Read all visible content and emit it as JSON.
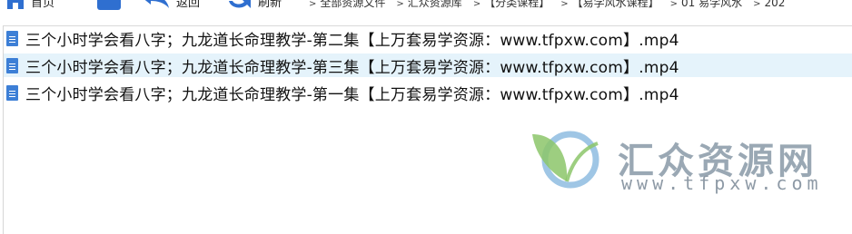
{
  "toolbar": {
    "home_label": "首页",
    "back_label": "返回",
    "refresh_label": "刷新"
  },
  "breadcrumbs": [
    "全部资源文件",
    "汇众资源库",
    "【分类课程】",
    "【易学风水课程】",
    "01 易学风水",
    "202"
  ],
  "files": [
    {
      "name": "三个小时学会看八字；九龙道长命理教学-第二集【上万套易学资源：www.tfpxw.com】.mp4"
    },
    {
      "name": "三个小时学会看八字；九龙道长命理教学-第三集【上万套易学资源：www.tfpxw.com】.mp4"
    },
    {
      "name": "三个小时学会看八字；九龙道长命理教学-第一集【上万套易学资源：www.tfpxw.com】.mp4"
    }
  ],
  "watermark": {
    "title": "汇众资源网",
    "url": "www.tfpxw.com"
  }
}
